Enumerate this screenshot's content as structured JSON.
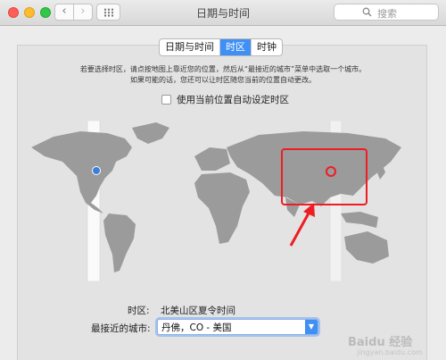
{
  "window": {
    "title": "日期与时间"
  },
  "toolbar": {
    "back_label": "‹",
    "forward_label": "›",
    "search_placeholder": "搜索"
  },
  "tabs": [
    {
      "label": "日期与时间",
      "active": false
    },
    {
      "label": "时区",
      "active": true
    },
    {
      "label": "时钟",
      "active": false
    }
  ],
  "instructions": {
    "line1": "若要选择时区，请点按地图上靠近您的位置，然后从“最接近的城市”菜单中选取一个城市。",
    "line2": "如果可能的话，您还可以让时区随您当前的位置自动更改。"
  },
  "auto_timezone": {
    "label": "使用当前位置自动设定时区",
    "checked": false
  },
  "timezone": {
    "label": "时区:",
    "value": "北美山区夏令时间"
  },
  "closest_city": {
    "label": "最接近的城市:",
    "value": "丹佛，CO - 美国"
  },
  "watermark": {
    "text": "Baidu 经验",
    "sub": "jingyan.baidu.com"
  },
  "colors": {
    "accent": "#3f8ff4",
    "annotation": "#ee1d23",
    "land": "#9b9b9b",
    "highlight_band": "#fafafa"
  }
}
